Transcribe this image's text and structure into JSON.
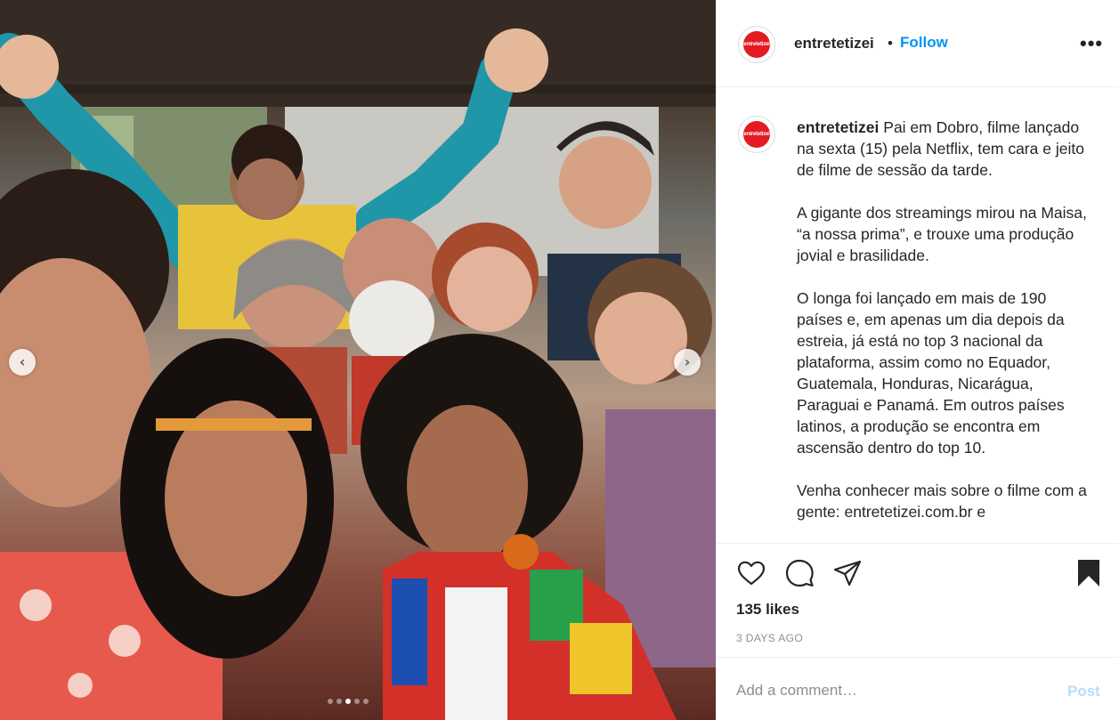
{
  "post": {
    "username": "entretetizei",
    "avatar_text": "entretetizei",
    "separator": "•",
    "follow_label": "Follow",
    "more_label": "•••",
    "caption": {
      "username": "entretetizei",
      "paragraph_1": "Pai em Dobro, filme lançado na sexta (15) pela Netflix, tem cara e jeito de filme de sessão da tarde.",
      "paragraph_2": "A gigante dos streamings mirou na Maisa, “a nossa prima”, e trouxe uma produção jovial e brasilidade.",
      "paragraph_3": "O longa foi lançado em mais de 190 países e, em apenas um dia depois da estreia, já está no top 3 nacional da plataforma, assim como no Equador, Guatemala, Honduras, Nicarágua, Paraguai e Panamá. Em outros países latinos, a produção se encontra em ascensão dentro do top 10.",
      "paragraph_4": "Venha conhecer mais sobre o filme com a gente: entretetizei.com.br e"
    },
    "likes": "135 likes",
    "date": "3 DAYS AGO",
    "comment_placeholder": "Add a comment…",
    "post_label": "Post"
  },
  "carousel": {
    "prev_icon": "chevron-left-icon",
    "next_icon": "chevron-right-icon",
    "total_slides": 5,
    "active_slide": 3
  },
  "icons": {
    "like": "heart-icon",
    "comment": "comment-bubble-icon",
    "share": "paper-plane-icon",
    "save": "bookmark-filled-icon"
  },
  "colors": {
    "follow": "#0095f6",
    "post_disabled": "#b2dffc",
    "secondary_text": "#8e8e8e",
    "brand_red": "#e31b23"
  }
}
